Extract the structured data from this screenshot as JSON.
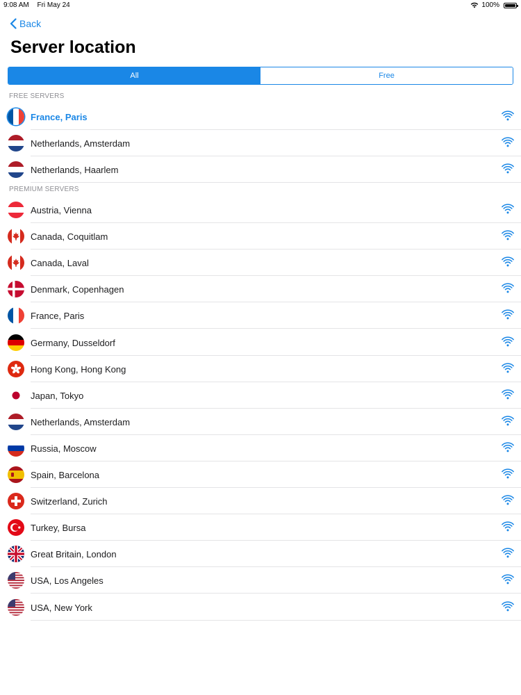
{
  "status_bar": {
    "time": "9:08 AM",
    "date": "Fri May 24",
    "battery": "100%"
  },
  "nav": {
    "back_label": "Back"
  },
  "page": {
    "title": "Server location"
  },
  "segments": {
    "all_label": "All",
    "free_label": "Free",
    "selected": "All"
  },
  "colors": {
    "accent": "#1a87e6",
    "section_text": "#8e8e93",
    "divider": "#e4e4e6"
  },
  "free_section": {
    "header": "FREE SERVERS",
    "servers": [
      {
        "label": "France, Paris",
        "flag": "fr",
        "selected": true
      },
      {
        "label": "Netherlands, Amsterdam",
        "flag": "nl"
      },
      {
        "label": "Netherlands, Haarlem",
        "flag": "nl"
      }
    ]
  },
  "premium_section": {
    "header": "PREMIUM SERVERS",
    "servers": [
      {
        "label": "Austria, Vienna",
        "flag": "at"
      },
      {
        "label": "Canada, Coquitlam",
        "flag": "ca"
      },
      {
        "label": "Canada, Laval",
        "flag": "ca"
      },
      {
        "label": "Denmark, Copenhagen",
        "flag": "dk"
      },
      {
        "label": "France, Paris",
        "flag": "fr"
      },
      {
        "label": "Germany, Dusseldorf",
        "flag": "de"
      },
      {
        "label": "Hong Kong, Hong Kong",
        "flag": "hk"
      },
      {
        "label": "Japan, Tokyo",
        "flag": "jp"
      },
      {
        "label": "Netherlands, Amsterdam",
        "flag": "nl"
      },
      {
        "label": "Russia, Moscow",
        "flag": "ru"
      },
      {
        "label": "Spain, Barcelona",
        "flag": "es"
      },
      {
        "label": "Switzerland, Zurich",
        "flag": "ch"
      },
      {
        "label": "Turkey, Bursa",
        "flag": "tr"
      },
      {
        "label": "Great Britain, London",
        "flag": "gb"
      },
      {
        "label": "USA, Los Angeles",
        "flag": "us"
      },
      {
        "label": "USA, New York",
        "flag": "us"
      }
    ]
  }
}
